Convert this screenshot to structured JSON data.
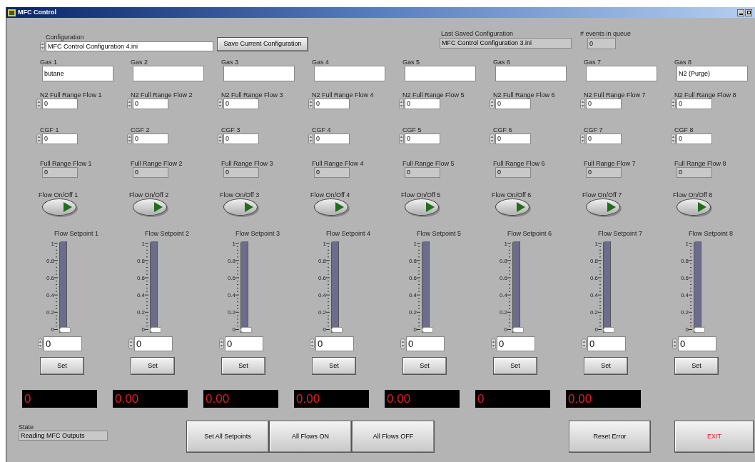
{
  "window": {
    "title": "MFC Control"
  },
  "configuration": {
    "label": "Configuration",
    "value": "MFC Control Configuration 4.ini"
  },
  "save_button": "Save Current Configuration",
  "last_saved": {
    "label": "Last Saved Configuration",
    "value": "MFC Control Configuration 3.ini"
  },
  "events": {
    "label": "# events in queue",
    "value": "0"
  },
  "channels": [
    {
      "gas_label": "Gas 1",
      "gas_value": "butane",
      "n2_label": "N2 Full Range Flow 1",
      "n2_value": "0",
      "cgf_label": "CGF 1",
      "cgf_value": "0",
      "frf_label": "Full Range Flow 1",
      "frf_value": "0",
      "flow_label": "Flow On/Off 1",
      "on": true,
      "setpoint_label": "Flow Setpoint 1",
      "ticks": [
        "1",
        "0.8",
        "0.6",
        "0.4",
        "0.2",
        "0"
      ],
      "level": 0,
      "setpoint_value": "0",
      "set_button": "Set"
    },
    {
      "gas_label": "Gas 2",
      "n2_label": "N2 Full Range Flow 2",
      "n2_value": "0",
      "cgf_label": "CGF 2",
      "cgf_value": "0",
      "frf_label": "Full Range Flow 2",
      "frf_value": "0",
      "flow_label": "Flow On/Off 2",
      "on": true,
      "setpoint_label": "Flow Setpoint 2",
      "ticks": [
        "1",
        "0.8",
        "0.6",
        "0.4",
        "0.2",
        "0"
      ],
      "level": 0,
      "setpoint_value": "0",
      "set_button": "Set"
    },
    {
      "gas_label": "Gas 3",
      "n2_label": "N2 Full Range Flow 3",
      "n2_value": "0",
      "cgf_label": "CGF 3",
      "cgf_value": "0",
      "frf_label": "Full Range Flow 3",
      "frf_value": "0",
      "flow_label": "Flow On/Off 3",
      "on": true,
      "setpoint_label": "Flow Setpoint 3",
      "ticks": [
        "1",
        "0.8",
        "0.6",
        "0.4",
        "0.2",
        "0"
      ],
      "level": 0,
      "setpoint_value": "0",
      "set_button": "Set"
    },
    {
      "gas_label": "Gas 4",
      "n2_label": "N2 Full Range Flow 4",
      "n2_value": "0",
      "cgf_label": "CGF 4",
      "cgf_value": "0",
      "frf_label": "Full Range Flow 4",
      "frf_value": "0",
      "flow_label": "Flow On/Off 4",
      "on": true,
      "setpoint_label": "Flow Setpoint 4",
      "ticks": [
        "1",
        "0.8",
        "0.6",
        "0.4",
        "0.2",
        "0"
      ],
      "level": 0,
      "setpoint_value": "0",
      "set_button": "Set"
    },
    {
      "gas_label": "Gas 5",
      "n2_label": "N2 Full Range Flow 5",
      "n2_value": "0",
      "cgf_label": "CGF 5",
      "cgf_value": "0",
      "frf_label": "Full Range Flow 5",
      "frf_value": "0",
      "flow_label": "Flow On/Off 5",
      "on": true,
      "setpoint_label": "Flow Setpoint 5",
      "ticks": [
        "1",
        "0.8",
        "0.6",
        "0.4",
        "0.2",
        "0"
      ],
      "level": 0,
      "setpoint_value": "0",
      "set_button": "Set"
    },
    {
      "gas_label": "Gas 6",
      "n2_label": "N2 Full Range Flow 6",
      "n2_value": "0",
      "cgf_label": "CGF 6",
      "cgf_value": "0",
      "frf_label": "Full Range Flow 6",
      "frf_value": "0",
      "flow_label": "Flow On/Off 6",
      "on": true,
      "setpoint_label": "Flow Setpoint 6",
      "ticks": [
        "1",
        "0.8",
        "0.6",
        "0.4",
        "0.2",
        "0"
      ],
      "level": 0,
      "setpoint_value": "0",
      "set_button": "Set"
    },
    {
      "gas_label": "Gas 7",
      "n2_label": "N2 Full Range Flow 7",
      "n2_value": "0",
      "cgf_label": "CGF 7",
      "cgf_value": "0",
      "frf_label": "Full Range Flow 7",
      "frf_value": "0",
      "flow_label": "Flow On/Off 7",
      "on": true,
      "setpoint_label": "Flow Setpoint 7",
      "ticks": [
        "1",
        "0.8",
        "0.6",
        "0.4",
        "0.2",
        "0"
      ],
      "level": 0,
      "setpoint_value": "0",
      "set_button": "Set"
    },
    {
      "gas_label": "Gas 8",
      "gas_value": "N2 (Purge)",
      "n2_label": "N2 Full Range Flow 8",
      "n2_value": "0",
      "cgf_label": "CGF 8",
      "cgf_value": "0",
      "frf_label": "Full Range Flow 8",
      "frf_value": "0",
      "flow_label": "Flow On/Off 8",
      "on": true,
      "setpoint_label": "Flow Setpoint 8",
      "ticks": [
        "1",
        "0.8",
        "0.6",
        "0.4",
        "0.2",
        "0"
      ],
      "level": 0,
      "setpoint_value": "0",
      "set_button": "Set"
    }
  ],
  "displays": [
    "0",
    "0.00",
    "0.00",
    "0.00",
    "0.00",
    "0",
    "0.00"
  ],
  "state": {
    "label": "State",
    "value": "Reading MFC Outputs"
  },
  "action_buttons": [
    "Set All Setpoints",
    "All Flows ON",
    "All Flows OFF"
  ],
  "reset_button": "Reset Error",
  "exit_button": "EXIT"
}
